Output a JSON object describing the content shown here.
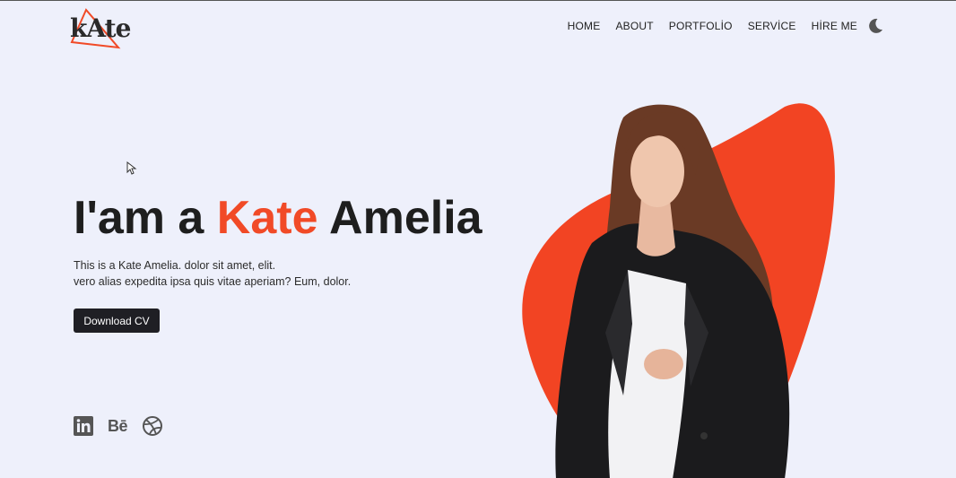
{
  "logo": {
    "text": "kAte"
  },
  "nav": {
    "items": [
      "HOME",
      "ABOUT",
      "PORTFOLİO",
      "SERVİCE",
      "HİRE ME"
    ]
  },
  "hero": {
    "title_prefix": "I'am a ",
    "title_accent": "Kate",
    "title_suffix": " Amelia",
    "desc_line1": "This is a Kate Amelia. dolor sit amet, elit.",
    "desc_line2": "vero alias expedita ipsa quis vitae aperiam? Eum, dolor.",
    "cv_button": "Download CV"
  },
  "socials": {
    "behance": "Bē",
    "icons": [
      "linkedin-icon",
      "behance-icon",
      "dribbble-icon"
    ]
  },
  "colors": {
    "accent": "#f14a27",
    "background": "#eef0fb",
    "dark": "#1f1f24"
  }
}
